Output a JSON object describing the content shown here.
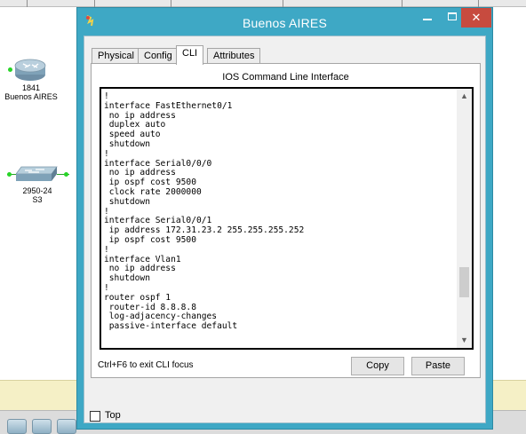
{
  "window": {
    "title": "Buenos AIRES",
    "minimize": "",
    "maximize": "",
    "close": "✕"
  },
  "tabs": [
    {
      "label": "Physical",
      "active": false
    },
    {
      "label": "Config",
      "active": false
    },
    {
      "label": "CLI",
      "active": true
    },
    {
      "label": "Attributes",
      "active": false
    }
  ],
  "cli": {
    "heading": "IOS Command Line Interface",
    "lines": [
      "!",
      "interface FastEthernet0/1",
      " no ip address",
      " duplex auto",
      " speed auto",
      " shutdown",
      "!",
      "interface Serial0/0/0",
      " no ip address",
      " ip ospf cost 9500",
      " clock rate 2000000",
      " shutdown",
      "!",
      "interface Serial0/0/1",
      " ip address 172.31.23.2 255.255.255.252",
      " ip ospf cost 9500",
      "!",
      "interface Vlan1",
      " no ip address",
      " shutdown",
      "!",
      "router ospf 1",
      " router-id 8.8.8.8",
      " log-adjacency-changes",
      " passive-interface default"
    ],
    "hint": "Ctrl+F6 to exit CLI focus",
    "copy_label": "Copy",
    "paste_label": "Paste",
    "scroll_up": "▲",
    "scroll_down": "▼"
  },
  "top_checkbox": {
    "label": "Top",
    "checked": false
  },
  "workspace": {
    "devices": [
      {
        "model": "1841",
        "name": "Buenos AIRES"
      },
      {
        "model": "2950-24",
        "name": "S3"
      }
    ],
    "colors": {
      "window_frame": "#3ea8c5",
      "close_button": "#c74b3f",
      "link": "#27d427"
    }
  }
}
